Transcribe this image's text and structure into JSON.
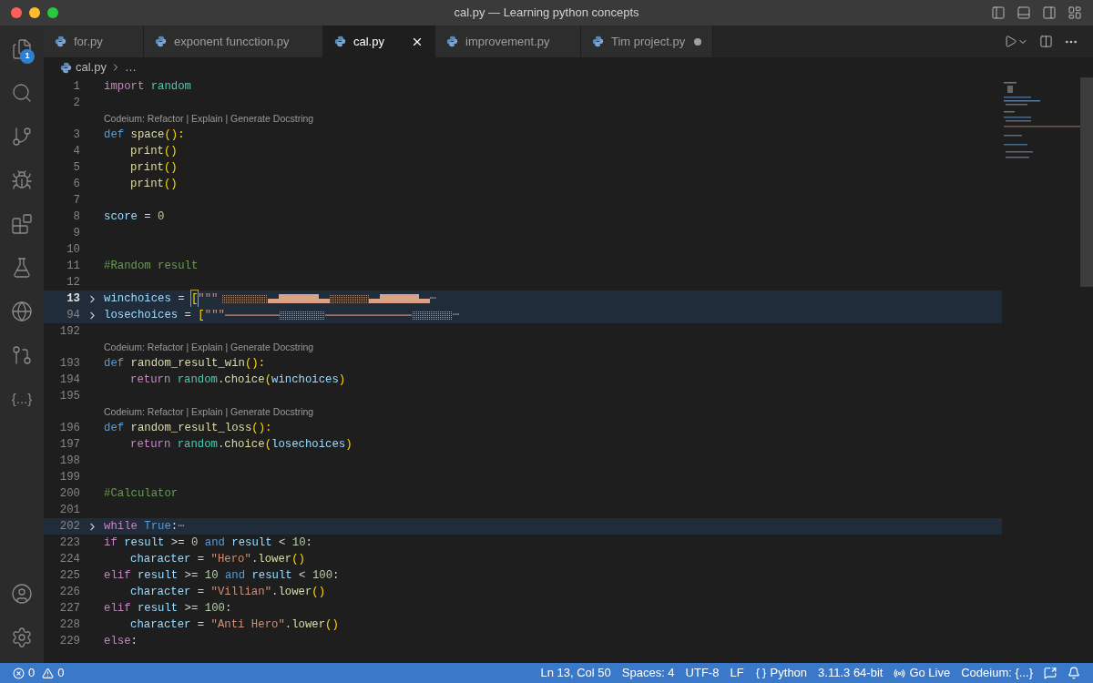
{
  "window": {
    "title": "cal.py — Learning python concepts"
  },
  "activity_bar": {
    "items": [
      {
        "kind": "files",
        "badge": "1"
      },
      {
        "kind": "search"
      },
      {
        "kind": "source-control"
      },
      {
        "kind": "run-debug"
      },
      {
        "kind": "extensions"
      },
      {
        "kind": "testing"
      },
      {
        "kind": "edge"
      },
      {
        "kind": "git-graph"
      },
      {
        "kind": "text",
        "text": "{...}"
      }
    ],
    "bottom": [
      {
        "kind": "account"
      },
      {
        "kind": "settings"
      }
    ]
  },
  "tabs": [
    {
      "label": "for.py",
      "selected": false,
      "modified": false
    },
    {
      "label": "exponent funcction.py",
      "selected": false,
      "modified": false
    },
    {
      "label": "cal.py",
      "selected": true,
      "modified": false
    },
    {
      "label": "improvement.py",
      "selected": false,
      "modified": false
    },
    {
      "label": "Tim project.py",
      "selected": false,
      "modified": true
    }
  ],
  "breadcrumb": [
    "cal.py",
    "…"
  ],
  "editor": {
    "lines": [
      {
        "kind": "code",
        "n": "1",
        "folded": false,
        "current": false,
        "indent": false,
        "tokens": [
          {
            "text": "import",
            "kind": "keyword"
          },
          {
            "text": "random",
            "kind": "module",
            "space": true
          }
        ]
      },
      {
        "kind": "code",
        "n": "2",
        "folded": false,
        "current": false
      },
      {
        "kind": "lens",
        "text": "Codeium: Refactor | Explain | Generate Docstring"
      },
      {
        "kind": "code",
        "n": "3",
        "folded": false,
        "current": false,
        "indent": false,
        "tokens": [
          {
            "text": "def",
            "kind": "storage"
          },
          {
            "text": "space",
            "kind": "function",
            "space": true
          },
          {
            "text": "():",
            "kind": "bracket"
          }
        ]
      },
      {
        "kind": "code",
        "n": "4",
        "folded": false,
        "current": false,
        "indent": true,
        "tokens": [
          {
            "text": "print",
            "kind": "function"
          },
          {
            "text": "()",
            "kind": "bracket"
          }
        ]
      },
      {
        "kind": "code",
        "n": "5",
        "folded": false,
        "current": false,
        "indent": true,
        "tokens": [
          {
            "text": "print",
            "kind": "function"
          },
          {
            "text": "()",
            "kind": "bracket"
          }
        ]
      },
      {
        "kind": "code",
        "n": "6",
        "folded": false,
        "current": false,
        "indent": true,
        "tokens": [
          {
            "text": "print",
            "kind": "function"
          },
          {
            "text": "()",
            "kind": "bracket"
          }
        ]
      },
      {
        "kind": "code",
        "n": "7",
        "folded": false,
        "current": false
      },
      {
        "kind": "code",
        "n": "8",
        "folded": false,
        "current": false,
        "indent": false,
        "tokens": [
          {
            "text": "score",
            "kind": "variable"
          },
          {
            "text": "=",
            "kind": "plain",
            "space": true
          },
          {
            "text": "0",
            "kind": "number",
            "space": true
          }
        ]
      },
      {
        "kind": "code",
        "n": "9",
        "folded": false,
        "current": false
      },
      {
        "kind": "code",
        "n": "10",
        "folded": false,
        "current": false
      },
      {
        "kind": "code",
        "n": "11",
        "folded": false,
        "current": false,
        "indent": false,
        "tokens": [
          {
            "text": "#Random result",
            "kind": "comment"
          }
        ]
      },
      {
        "kind": "code",
        "n": "12",
        "folded": false,
        "current": false
      },
      {
        "kind": "code",
        "n": "13",
        "folded": true,
        "current": true,
        "indent": false,
        "tokens": [
          {
            "text": "winchoices",
            "kind": "variable"
          },
          {
            "text": "=",
            "kind": "plain",
            "space": true
          },
          {
            "text": "[",
            "kind": "matched-bracket",
            "space": true
          },
          {
            "text": "\"\"\"",
            "kind": "string"
          }
        ],
        "preview": {
          "kind": "blocks"
        },
        "ellipsis": "⋯"
      },
      {
        "kind": "code",
        "n": "94",
        "folded": true,
        "current": false,
        "indent": false,
        "tokens": [
          {
            "text": "losechoices",
            "kind": "variable"
          },
          {
            "text": "=",
            "kind": "plain",
            "space": true
          },
          {
            "text": "[",
            "kind": "bracket",
            "space": true
          },
          {
            "text": "\"\"\"",
            "kind": "string"
          }
        ],
        "preview": {
          "kind": "lines"
        },
        "ellipsis": "⋯"
      },
      {
        "kind": "code",
        "n": "192",
        "folded": false,
        "current": false
      },
      {
        "kind": "lens",
        "text": "Codeium: Refactor | Explain | Generate Docstring"
      },
      {
        "kind": "code",
        "n": "193",
        "folded": false,
        "current": false,
        "indent": false,
        "tokens": [
          {
            "text": "def",
            "kind": "storage"
          },
          {
            "text": "random_result_win",
            "kind": "function",
            "space": true
          },
          {
            "text": "():",
            "kind": "bracket"
          }
        ]
      },
      {
        "kind": "code",
        "n": "194",
        "folded": false,
        "current": false,
        "indent": true,
        "tokens": [
          {
            "text": "return",
            "kind": "keyword"
          },
          {
            "text": "random",
            "kind": "module",
            "space": true
          },
          {
            "text": ".",
            "kind": "plain"
          },
          {
            "text": "choice",
            "kind": "function"
          },
          {
            "text": "(",
            "kind": "bracket"
          },
          {
            "text": "winchoices",
            "kind": "variable"
          },
          {
            "text": ")",
            "kind": "bracket"
          }
        ]
      },
      {
        "kind": "code",
        "n": "195",
        "folded": false,
        "current": false
      },
      {
        "kind": "lens",
        "text": "Codeium: Refactor | Explain | Generate Docstring"
      },
      {
        "kind": "code",
        "n": "196",
        "folded": false,
        "current": false,
        "indent": false,
        "tokens": [
          {
            "text": "def",
            "kind": "storage"
          },
          {
            "text": "random_result_loss",
            "kind": "function",
            "space": true
          },
          {
            "text": "():",
            "kind": "bracket"
          }
        ]
      },
      {
        "kind": "code",
        "n": "197",
        "folded": false,
        "current": false,
        "indent": true,
        "tokens": [
          {
            "text": "return",
            "kind": "keyword"
          },
          {
            "text": "random",
            "kind": "module",
            "space": true
          },
          {
            "text": ".",
            "kind": "plain"
          },
          {
            "text": "choice",
            "kind": "function"
          },
          {
            "text": "(",
            "kind": "bracket"
          },
          {
            "text": "losechoices",
            "kind": "variable"
          },
          {
            "text": ")",
            "kind": "bracket"
          }
        ]
      },
      {
        "kind": "code",
        "n": "198",
        "folded": false,
        "current": false
      },
      {
        "kind": "code",
        "n": "199",
        "folded": false,
        "current": false
      },
      {
        "kind": "code",
        "n": "200",
        "folded": false,
        "current": false,
        "indent": false,
        "tokens": [
          {
            "text": "#Calculator",
            "kind": "comment"
          }
        ]
      },
      {
        "kind": "code",
        "n": "201",
        "folded": false,
        "current": false
      },
      {
        "kind": "code",
        "n": "202",
        "folded": true,
        "current": false,
        "indent": false,
        "tokens": [
          {
            "text": "while",
            "kind": "keyword"
          },
          {
            "text": "True",
            "kind": "constant",
            "space": true
          },
          {
            "text": ":",
            "kind": "plain"
          }
        ],
        "ellipsis": "⋯"
      },
      {
        "kind": "code",
        "n": "223",
        "folded": false,
        "current": false,
        "indent": false,
        "tokens": [
          {
            "text": "if",
            "kind": "keyword"
          },
          {
            "text": "result",
            "kind": "variable",
            "space": true
          },
          {
            "text": ">=",
            "kind": "plain",
            "space": true
          },
          {
            "text": "0",
            "kind": "number",
            "space": true
          },
          {
            "text": "and",
            "kind": "storage",
            "space": true
          },
          {
            "text": "result",
            "kind": "variable",
            "space": true
          },
          {
            "text": "<",
            "kind": "plain",
            "space": true
          },
          {
            "text": "10",
            "kind": "number",
            "space": true
          },
          {
            "text": ":",
            "kind": "plain"
          }
        ]
      },
      {
        "kind": "code",
        "n": "224",
        "folded": false,
        "current": false,
        "indent": true,
        "tokens": [
          {
            "text": "character",
            "kind": "variable"
          },
          {
            "text": "=",
            "kind": "plain",
            "space": true
          },
          {
            "text": "\"Hero\"",
            "kind": "string",
            "space": true
          },
          {
            "text": ".",
            "kind": "plain"
          },
          {
            "text": "lower",
            "kind": "function"
          },
          {
            "text": "()",
            "kind": "bracket"
          }
        ]
      },
      {
        "kind": "code",
        "n": "225",
        "folded": false,
        "current": false,
        "indent": false,
        "tokens": [
          {
            "text": "elif",
            "kind": "keyword"
          },
          {
            "text": "result",
            "kind": "variable",
            "space": true
          },
          {
            "text": ">=",
            "kind": "plain",
            "space": true
          },
          {
            "text": "10",
            "kind": "number",
            "space": true
          },
          {
            "text": "and",
            "kind": "storage",
            "space": true
          },
          {
            "text": "result",
            "kind": "variable",
            "space": true
          },
          {
            "text": "<",
            "kind": "plain",
            "space": true
          },
          {
            "text": "100",
            "kind": "number",
            "space": true
          },
          {
            "text": ":",
            "kind": "plain"
          }
        ]
      },
      {
        "kind": "code",
        "n": "226",
        "folded": false,
        "current": false,
        "indent": true,
        "tokens": [
          {
            "text": "character",
            "kind": "variable"
          },
          {
            "text": "=",
            "kind": "plain",
            "space": true
          },
          {
            "text": "\"Villian\"",
            "kind": "string",
            "space": true
          },
          {
            "text": ".",
            "kind": "plain"
          },
          {
            "text": "lower",
            "kind": "function"
          },
          {
            "text": "()",
            "kind": "bracket"
          }
        ]
      },
      {
        "kind": "code",
        "n": "227",
        "folded": false,
        "current": false,
        "indent": false,
        "tokens": [
          {
            "text": "elif",
            "kind": "keyword"
          },
          {
            "text": "result",
            "kind": "variable",
            "space": true
          },
          {
            "text": ">=",
            "kind": "plain",
            "space": true
          },
          {
            "text": "100",
            "kind": "number",
            "space": true
          },
          {
            "text": ":",
            "kind": "plain"
          }
        ]
      },
      {
        "kind": "code",
        "n": "228",
        "folded": false,
        "current": false,
        "indent": true,
        "tokens": [
          {
            "text": "character",
            "kind": "variable"
          },
          {
            "text": "=",
            "kind": "plain",
            "space": true
          },
          {
            "text": "\"Anti Hero\"",
            "kind": "string",
            "space": true
          },
          {
            "text": ".",
            "kind": "plain"
          },
          {
            "text": "lower",
            "kind": "function"
          },
          {
            "text": "()",
            "kind": "bracket"
          }
        ]
      },
      {
        "kind": "code",
        "n": "229",
        "folded": false,
        "current": false,
        "indent": false,
        "tokens": [
          {
            "text": "else",
            "kind": "keyword"
          },
          {
            "text": ":",
            "kind": "plain"
          }
        ]
      }
    ]
  },
  "status_bar": {
    "left": [
      {
        "kind": "errors",
        "text": "0"
      },
      {
        "kind": "warnings",
        "text": "0"
      }
    ],
    "right": [
      {
        "kind": "text",
        "text": "Ln 13, Col 50"
      },
      {
        "kind": "text",
        "text": "Spaces: 4"
      },
      {
        "kind": "text",
        "text": "UTF-8"
      },
      {
        "kind": "text",
        "text": "LF"
      },
      {
        "kind": "language",
        "text": "Python"
      },
      {
        "kind": "text",
        "text": "3.11.3 64-bit"
      },
      {
        "kind": "live",
        "text": "Go Live"
      },
      {
        "kind": "text",
        "text": "Codeium: {...}"
      },
      {
        "kind": "feedback"
      },
      {
        "kind": "bell"
      }
    ]
  }
}
